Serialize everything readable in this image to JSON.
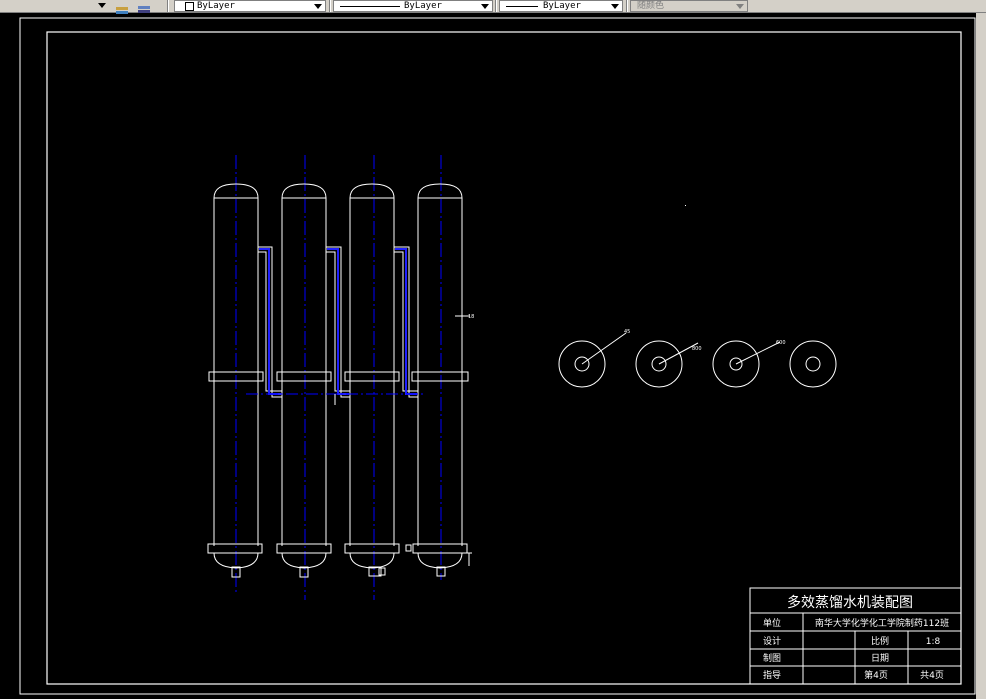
{
  "toolbar": {
    "layer_props_icon": "layer-properties-icon",
    "layer_state_icon": "layer-state-icon",
    "color_value": "ByLayer",
    "linetype_value": "ByLayer",
    "lineweight_value": "ByLayer",
    "plotstyle_value": "随颜色"
  },
  "title_block": {
    "title": "多效蒸馏水机装配图",
    "unit_label": "单位",
    "unit_value": "南华大学化学化工学院制药112班",
    "design_label": "设计",
    "scale_label": "比例",
    "scale_value": "1:8",
    "drawing_label": "制图",
    "date_label": "日期",
    "guide_label": "指导",
    "sheet_label": "第4页",
    "total_label": "共4页"
  },
  "annotations": {
    "right_leader": "18",
    "c1_leader": "45",
    "c2_leader": "800",
    "c3_leader": "600"
  },
  "colors": {
    "paper": "#000000",
    "line": "#ffffff",
    "centerline": "#0000ff",
    "toolbar": "#d4d0c8"
  }
}
